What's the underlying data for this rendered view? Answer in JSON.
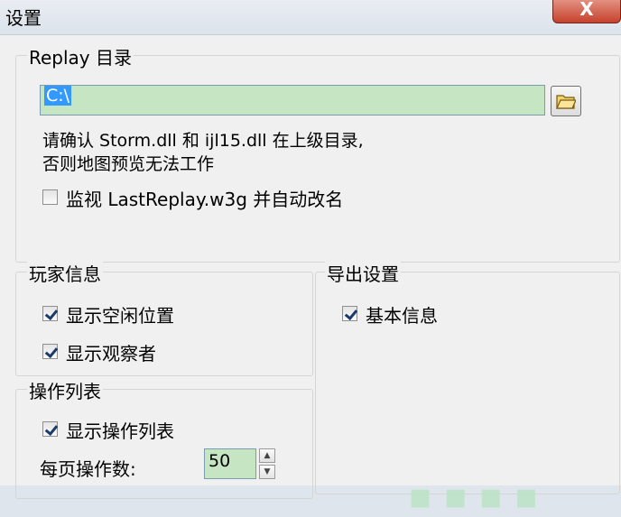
{
  "window": {
    "title": "设置",
    "close_label": "X"
  },
  "replay_group": {
    "legend": "Replay 目录",
    "path_value": "C:\\",
    "note_line1": "请确认 Storm.dll 和 ijl15.dll 在上级目录,",
    "note_line2": "否则地图预览无法工作",
    "monitor_label": "监视 LastReplay.w3g 并自动改名",
    "monitor_checked": false,
    "browse_icon": "folder-icon"
  },
  "player_group": {
    "legend": "玩家信息",
    "show_idle_label": "显示空闲位置",
    "show_idle_checked": true,
    "show_observer_label": "显示观察者",
    "show_observer_checked": true
  },
  "export_group": {
    "legend": "导出设置",
    "basic_info_label": "基本信息",
    "basic_info_checked": true
  },
  "action_group": {
    "legend": "操作列表",
    "show_actions_label": "显示操作列表",
    "show_actions_checked": true,
    "per_page_label": "每页操作数:",
    "per_page_value": "50"
  },
  "colors": {
    "input_bg": "#c6e6c3",
    "selection": "#3399ff",
    "close_red": "#c7412d"
  }
}
